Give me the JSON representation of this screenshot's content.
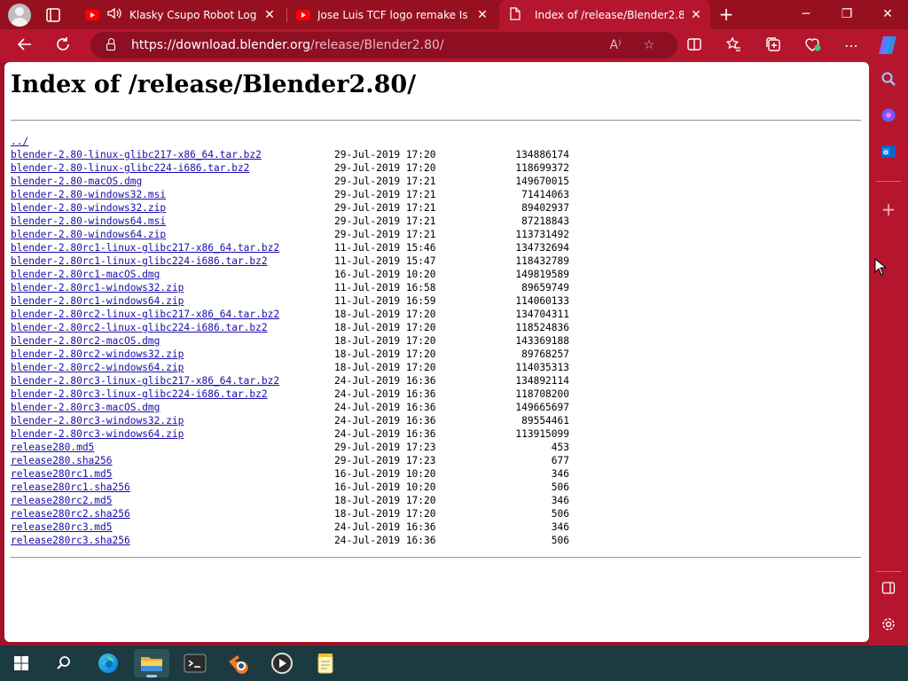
{
  "browser": {
    "tabs": [
      {
        "title": "Klasky Csupo Robot Logo Up",
        "favicon": "youtube-icon",
        "audio": true
      },
      {
        "title": "Jose Luis TCF logo remake Is Back",
        "favicon": "youtube-icon",
        "audio": false
      },
      {
        "title": "Index of /release/Blender2.80/",
        "favicon": "page-icon",
        "active": true
      }
    ],
    "address": {
      "host": "https://download.blender.org",
      "path": "/release/Blender2.80/"
    },
    "accent_color": "#b5162e"
  },
  "page": {
    "heading": "Index of /release/Blender2.80/",
    "parent_link": "../",
    "files": [
      {
        "name": "blender-2.80-linux-glibc217-x86_64.tar.bz2",
        "date": "29-Jul-2019 17:20",
        "size": "134886174"
      },
      {
        "name": "blender-2.80-linux-glibc224-i686.tar.bz2",
        "date": "29-Jul-2019 17:20",
        "size": "118699372"
      },
      {
        "name": "blender-2.80-macOS.dmg",
        "date": "29-Jul-2019 17:21",
        "size": "149670015"
      },
      {
        "name": "blender-2.80-windows32.msi",
        "date": "29-Jul-2019 17:21",
        "size": "71414063"
      },
      {
        "name": "blender-2.80-windows32.zip",
        "date": "29-Jul-2019 17:21",
        "size": "89402937"
      },
      {
        "name": "blender-2.80-windows64.msi",
        "date": "29-Jul-2019 17:21",
        "size": "87218843"
      },
      {
        "name": "blender-2.80-windows64.zip",
        "date": "29-Jul-2019 17:21",
        "size": "113731492"
      },
      {
        "name": "blender-2.80rc1-linux-glibc217-x86_64.tar.bz2",
        "date": "11-Jul-2019 15:46",
        "size": "134732694"
      },
      {
        "name": "blender-2.80rc1-linux-glibc224-i686.tar.bz2",
        "date": "11-Jul-2019 15:47",
        "size": "118432789"
      },
      {
        "name": "blender-2.80rc1-macOS.dmg",
        "date": "16-Jul-2019 10:20",
        "size": "149819589"
      },
      {
        "name": "blender-2.80rc1-windows32.zip",
        "date": "11-Jul-2019 16:58",
        "size": "89659749"
      },
      {
        "name": "blender-2.80rc1-windows64.zip",
        "date": "11-Jul-2019 16:59",
        "size": "114060133"
      },
      {
        "name": "blender-2.80rc2-linux-glibc217-x86_64.tar.bz2",
        "date": "18-Jul-2019 17:20",
        "size": "134704311"
      },
      {
        "name": "blender-2.80rc2-linux-glibc224-i686.tar.bz2",
        "date": "18-Jul-2019 17:20",
        "size": "118524836"
      },
      {
        "name": "blender-2.80rc2-macOS.dmg",
        "date": "18-Jul-2019 17:20",
        "size": "143369188"
      },
      {
        "name": "blender-2.80rc2-windows32.zip",
        "date": "18-Jul-2019 17:20",
        "size": "89768257"
      },
      {
        "name": "blender-2.80rc2-windows64.zip",
        "date": "18-Jul-2019 17:20",
        "size": "114035313"
      },
      {
        "name": "blender-2.80rc3-linux-glibc217-x86_64.tar.bz2",
        "date": "24-Jul-2019 16:36",
        "size": "134892114"
      },
      {
        "name": "blender-2.80rc3-linux-glibc224-i686.tar.bz2",
        "date": "24-Jul-2019 16:36",
        "size": "118708200"
      },
      {
        "name": "blender-2.80rc3-macOS.dmg",
        "date": "24-Jul-2019 16:36",
        "size": "149665697"
      },
      {
        "name": "blender-2.80rc3-windows32.zip",
        "date": "24-Jul-2019 16:36",
        "size": "89554461"
      },
      {
        "name": "blender-2.80rc3-windows64.zip",
        "date": "24-Jul-2019 16:36",
        "size": "113915099"
      },
      {
        "name": "release280.md5",
        "date": "29-Jul-2019 17:23",
        "size": "453"
      },
      {
        "name": "release280.sha256",
        "date": "29-Jul-2019 17:23",
        "size": "677"
      },
      {
        "name": "release280rc1.md5",
        "date": "16-Jul-2019 10:20",
        "size": "346"
      },
      {
        "name": "release280rc1.sha256",
        "date": "16-Jul-2019 10:20",
        "size": "506"
      },
      {
        "name": "release280rc2.md5",
        "date": "18-Jul-2019 17:20",
        "size": "346"
      },
      {
        "name": "release280rc2.sha256",
        "date": "18-Jul-2019 17:20",
        "size": "506"
      },
      {
        "name": "release280rc3.md5",
        "date": "24-Jul-2019 16:36",
        "size": "346"
      },
      {
        "name": "release280rc3.sha256",
        "date": "24-Jul-2019 16:36",
        "size": "506"
      }
    ]
  },
  "sidebar": {
    "icons": [
      "search-icon",
      "copilot-icon",
      "outlook-icon",
      "add-icon",
      "sidebar-panel-icon",
      "settings-icon"
    ]
  },
  "taskbar": {
    "apps": [
      "windows-start-icon",
      "search-icon",
      "edge-icon",
      "file-explorer-icon",
      "terminal-icon",
      "blender-icon",
      "media-player-icon",
      "notepad-icon"
    ],
    "active_app": "file-explorer-icon",
    "background": "#1b3b41"
  }
}
